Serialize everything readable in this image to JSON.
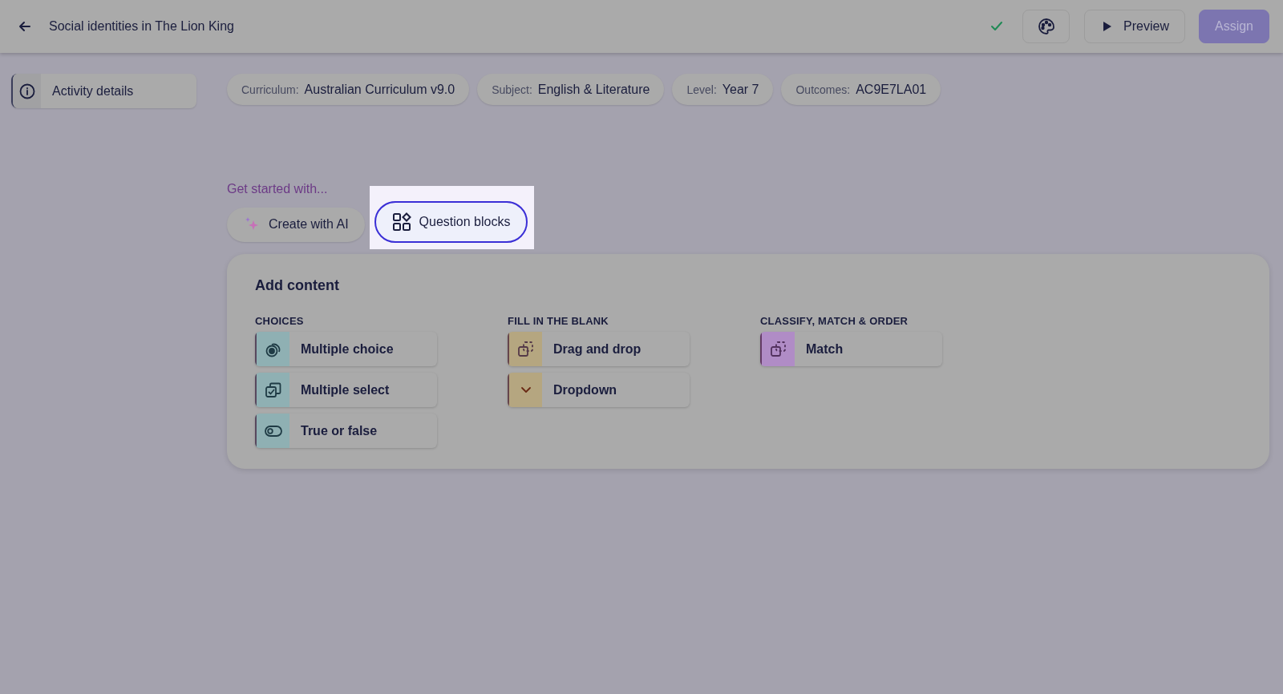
{
  "header": {
    "title": "Social identities in The Lion King",
    "saved": true,
    "preview_label": "Preview",
    "assign_label": "Assign"
  },
  "sidebar": {
    "items": [
      {
        "label": "Activity details",
        "selected": true
      }
    ]
  },
  "metadata": [
    {
      "key": "Curriculum:",
      "value": "Australian Curriculum v9.0"
    },
    {
      "key": "Subject:",
      "value": "English & Literature"
    },
    {
      "key": "Level:",
      "value": "Year 7"
    },
    {
      "key": "Outcomes:",
      "value": "AC9E7LA01"
    }
  ],
  "get_started": {
    "heading": "Get started with...",
    "options": [
      {
        "label": "Create with AI",
        "kind": "ai",
        "highlighted": false
      },
      {
        "label": "Question blocks",
        "kind": "blocks",
        "highlighted": true
      }
    ]
  },
  "add_content": {
    "title": "Add content",
    "groups": [
      {
        "heading": "CHOICES",
        "color": "#8fb0b3",
        "items": [
          {
            "label": "Multiple choice",
            "kind": "choice"
          },
          {
            "label": "Multiple select",
            "kind": "select"
          },
          {
            "label": "True or false",
            "kind": "toggle"
          }
        ]
      },
      {
        "heading": "FILL IN THE BLANK",
        "color": "#b5a680",
        "items": [
          {
            "label": "Drag and drop",
            "kind": "drag"
          },
          {
            "label": "Dropdown",
            "kind": "dropdown"
          }
        ]
      },
      {
        "heading": "CLASSIFY, MATCH & ORDER",
        "color": "#b08cc6",
        "items": [
          {
            "label": "Match",
            "kind": "drag"
          }
        ]
      }
    ]
  }
}
